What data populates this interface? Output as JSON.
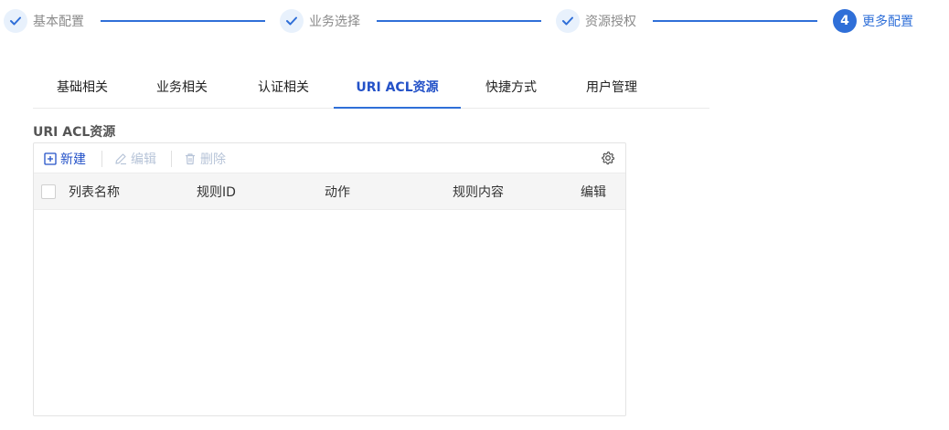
{
  "steps": [
    {
      "label": "基本配置",
      "status": "done"
    },
    {
      "label": "业务选择",
      "status": "done"
    },
    {
      "label": "资源授权",
      "status": "done"
    },
    {
      "label": "更多配置",
      "status": "active",
      "number": "4"
    }
  ],
  "tabs": [
    "基础相关",
    "业务相关",
    "认证相关",
    "URI ACL资源",
    "快捷方式",
    "用户管理"
  ],
  "active_tab": "URI ACL资源",
  "section": {
    "title": "URI ACL资源"
  },
  "toolbar": {
    "new_label": "新建",
    "edit_label": "编辑",
    "delete_label": "删除",
    "settings_icon": "gear-icon"
  },
  "table": {
    "columns": [
      "列表名称",
      "规则ID",
      "动作",
      "规则内容",
      "编辑"
    ],
    "rows": []
  },
  "colors": {
    "accent": "#2f6fd8",
    "active_tab_text": "#2452c8",
    "disabled": "#b7c4d8",
    "step_done_bg": "#e8f1fc"
  }
}
